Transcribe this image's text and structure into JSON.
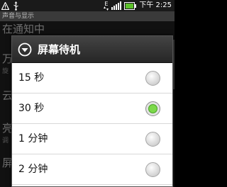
{
  "status_bar": {
    "time": "下午 2:25",
    "icons": [
      "warning-icon",
      "usb-icon",
      "data-e-icon",
      "signal-icon",
      "battery-icon"
    ],
    "data_label": "E"
  },
  "background": {
    "section_header": "声音与显示",
    "items": [
      {
        "label": "在通知中"
      },
      {
        "label": "万"
      },
      {
        "label": "云"
      },
      {
        "label": "亮"
      },
      {
        "label": "屏"
      }
    ],
    "subs": [
      "旋",
      "调"
    ]
  },
  "dialog": {
    "title": "屏幕待机",
    "title_icon": "chevron-down-circle-icon",
    "options": [
      {
        "label": "15 秒",
        "checked": false
      },
      {
        "label": "30 秒",
        "checked": true
      },
      {
        "label": "1 分钟",
        "checked": false
      },
      {
        "label": "2 分钟",
        "checked": false
      }
    ]
  },
  "colors": {
    "dialog_header": "#2e2e2e",
    "radio_checked": "#5cc02a",
    "background": "#111111"
  }
}
